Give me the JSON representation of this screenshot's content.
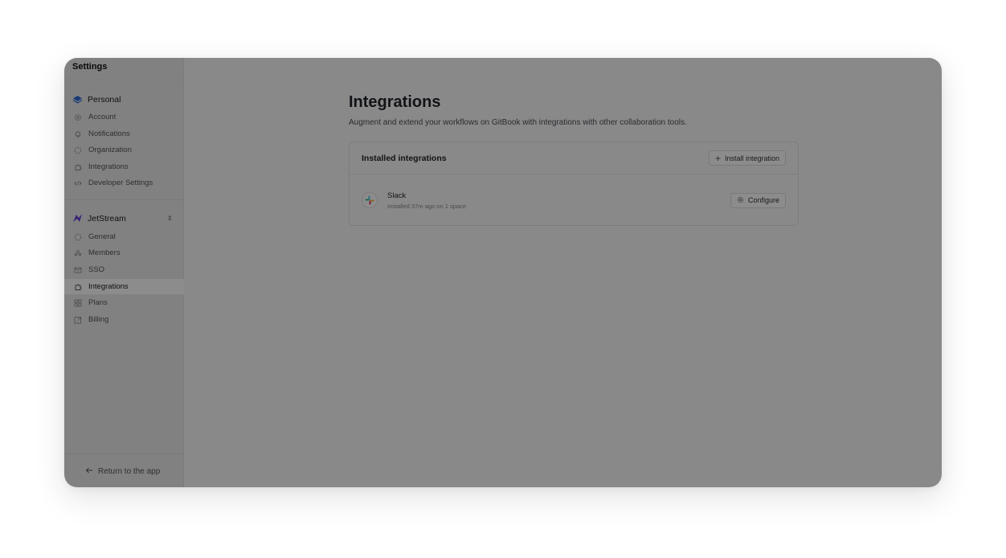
{
  "sidebar": {
    "title": "Settings",
    "personal": {
      "label": "Personal",
      "items": [
        {
          "label": "Account",
          "icon": "gear-icon"
        },
        {
          "label": "Notifications",
          "icon": "bell-icon"
        },
        {
          "label": "Organization",
          "icon": "dashed-circle-icon"
        },
        {
          "label": "Integrations",
          "icon": "puzzle-icon"
        },
        {
          "label": "Developer Settings",
          "icon": "code-icon"
        }
      ]
    },
    "org": {
      "label": "JetStream",
      "items": [
        {
          "label": "General",
          "icon": "dashed-circle-icon"
        },
        {
          "label": "Members",
          "icon": "people-icon"
        },
        {
          "label": "SSO",
          "icon": "mail-icon"
        },
        {
          "label": "Integrations",
          "icon": "puzzle-icon",
          "active": true
        },
        {
          "label": "Plans",
          "icon": "grid-icon"
        },
        {
          "label": "Billing",
          "icon": "external-icon"
        }
      ]
    },
    "return_label": "Return to the app"
  },
  "main": {
    "title": "Integrations",
    "subtitle": "Augment and extend your workflows on GitBook with integrations with other collaboration tools.",
    "card": {
      "title": "Installed integrations",
      "install_label": "Install integration",
      "items": [
        {
          "name": "Slack",
          "meta": "Installed 37m ago on 1 space",
          "configure_label": "Configure"
        }
      ]
    }
  },
  "colors": {
    "personal_logo": "#2f6bd8",
    "jetstream_logo": "#6a3fd8",
    "overlay": "#000000"
  }
}
